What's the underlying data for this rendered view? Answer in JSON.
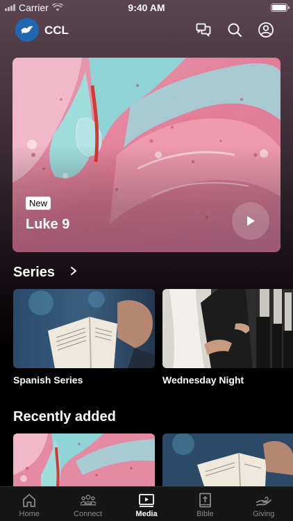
{
  "status": {
    "carrier": "Carrier",
    "time": "9:40 AM"
  },
  "header": {
    "brand": "CCL"
  },
  "hero": {
    "badge": "New",
    "title": "Luke 9"
  },
  "series": {
    "title": "Series",
    "items": [
      {
        "label": "Spanish Series"
      },
      {
        "label": "Wednesday Night"
      }
    ]
  },
  "recent": {
    "title": "Recently added"
  },
  "tabs": [
    {
      "label": "Home",
      "icon": "home-icon"
    },
    {
      "label": "Connect",
      "icon": "people-icon"
    },
    {
      "label": "Media",
      "icon": "media-icon",
      "active": true
    },
    {
      "label": "Bible",
      "icon": "bible-icon"
    },
    {
      "label": "Giving",
      "icon": "giving-icon"
    }
  ]
}
